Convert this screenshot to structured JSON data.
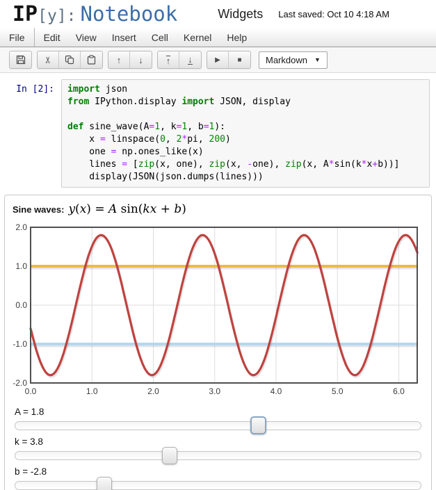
{
  "header": {
    "logo_ip": "IP",
    "logo_y": "[y]:",
    "logo_notebook": "Notebook",
    "notebook_title": "Widgets",
    "last_saved": "Last saved: Oct 10 4:18 AM"
  },
  "menu": {
    "items": [
      "File",
      "Edit",
      "View",
      "Insert",
      "Cell",
      "Kernel",
      "Help"
    ]
  },
  "toolbar": {
    "icons": [
      "save",
      "cut",
      "copy",
      "paste",
      "move-up",
      "move-down",
      "run-to-top",
      "run-to-bottom",
      "run",
      "stop"
    ],
    "groups": [
      [
        "save"
      ],
      [
        "cut",
        "copy",
        "paste"
      ],
      [
        "move-up",
        "move-down"
      ],
      [
        "run-to-top",
        "run-to-bottom"
      ],
      [
        "run",
        "stop"
      ]
    ],
    "cell_type": "Markdown"
  },
  "cell": {
    "prompt": "In [2]:",
    "code_lines": [
      [
        [
          "kw",
          "import"
        ],
        [
          "pl",
          " json"
        ]
      ],
      [
        [
          "kw",
          "from"
        ],
        [
          "pl",
          " IPython.display "
        ],
        [
          "kw",
          "import"
        ],
        [
          "pl",
          " JSON, display"
        ]
      ],
      [],
      [
        [
          "kw",
          "def"
        ],
        [
          "pl",
          " sine_wave(A"
        ],
        [
          "op",
          "="
        ],
        [
          "nm",
          "1"
        ],
        [
          "pl",
          ", k"
        ],
        [
          "op",
          "="
        ],
        [
          "nm",
          "1"
        ],
        [
          "pl",
          ", b"
        ],
        [
          "op",
          "="
        ],
        [
          "nm",
          "1"
        ],
        [
          "pl",
          "):"
        ]
      ],
      [
        [
          "pl",
          "    x "
        ],
        [
          "op",
          "="
        ],
        [
          "pl",
          " linspace("
        ],
        [
          "nm",
          "0"
        ],
        [
          "pl",
          ", "
        ],
        [
          "nm",
          "2"
        ],
        [
          "op",
          "*"
        ],
        [
          "pl",
          "pi, "
        ],
        [
          "nm",
          "200"
        ],
        [
          "pl",
          ")"
        ]
      ],
      [
        [
          "pl",
          "    one "
        ],
        [
          "op",
          "="
        ],
        [
          "pl",
          " np.ones_like(x)"
        ]
      ],
      [
        [
          "pl",
          "    lines "
        ],
        [
          "op",
          "="
        ],
        [
          "pl",
          " ["
        ],
        [
          "bi",
          "zip"
        ],
        [
          "pl",
          "(x, one), "
        ],
        [
          "bi",
          "zip"
        ],
        [
          "pl",
          "(x, "
        ],
        [
          "op",
          "-"
        ],
        [
          "pl",
          "one), "
        ],
        [
          "bi",
          "zip"
        ],
        [
          "pl",
          "(x, A"
        ],
        [
          "op",
          "*"
        ],
        [
          "pl",
          "sin(k"
        ],
        [
          "op",
          "*"
        ],
        [
          "pl",
          "x"
        ],
        [
          "op",
          "+"
        ],
        [
          "pl",
          "b))]"
        ]
      ],
      [
        [
          "pl",
          "    display(JSON(json.dumps(lines)))"
        ]
      ]
    ]
  },
  "widget": {
    "title_label": "Sine waves:",
    "title_math_segments": [
      {
        "text": "y",
        "italic": true
      },
      {
        "text": "(",
        "italic": false
      },
      {
        "text": "x",
        "italic": true
      },
      {
        "text": ") = ",
        "italic": false
      },
      {
        "text": "A",
        "italic": true
      },
      {
        "text": " sin(",
        "italic": false
      },
      {
        "text": "kx",
        "italic": true
      },
      {
        "text": " + ",
        "italic": false
      },
      {
        "text": "b",
        "italic": true
      },
      {
        "text": ")",
        "italic": false
      }
    ],
    "sliders": [
      {
        "label": "A = 1.8",
        "position_pct": 59.8,
        "active": true
      },
      {
        "label": "k = 3.8",
        "position_pct": 38.0,
        "active": false
      },
      {
        "label": "b = -2.8",
        "position_pct": 22.0,
        "active": false
      }
    ]
  },
  "chart_data": {
    "type": "line",
    "title": "Sine waves: y(x) = A sin(kx + b)",
    "xlim": [
      0,
      6.3
    ],
    "ylim": [
      -2,
      2
    ],
    "xticks": [
      "0.0",
      "1.0",
      "2.0",
      "3.0",
      "4.0",
      "5.0",
      "6.0"
    ],
    "yticks": [
      "2.0",
      "1.0",
      "0.0",
      "-1.0",
      "-2.0"
    ],
    "grid": true,
    "legend": "none",
    "series": [
      {
        "name": "one",
        "kind": "hline",
        "y": 1,
        "color": "#E9BC45",
        "width": 4
      },
      {
        "name": "-one",
        "kind": "hline",
        "y": -1,
        "color": "#B5D7EE",
        "width": 4
      },
      {
        "name": "A*sin(k*x+b)",
        "kind": "sine",
        "formula": "y = A*sin(k*x+b)",
        "A": 1.8,
        "k": 3.8,
        "b": -2.8,
        "n_points": 200,
        "color": "#BF423F",
        "width": 3.2
      }
    ],
    "grid_color": "#dddddd",
    "border_color": "#4f4f4f"
  }
}
